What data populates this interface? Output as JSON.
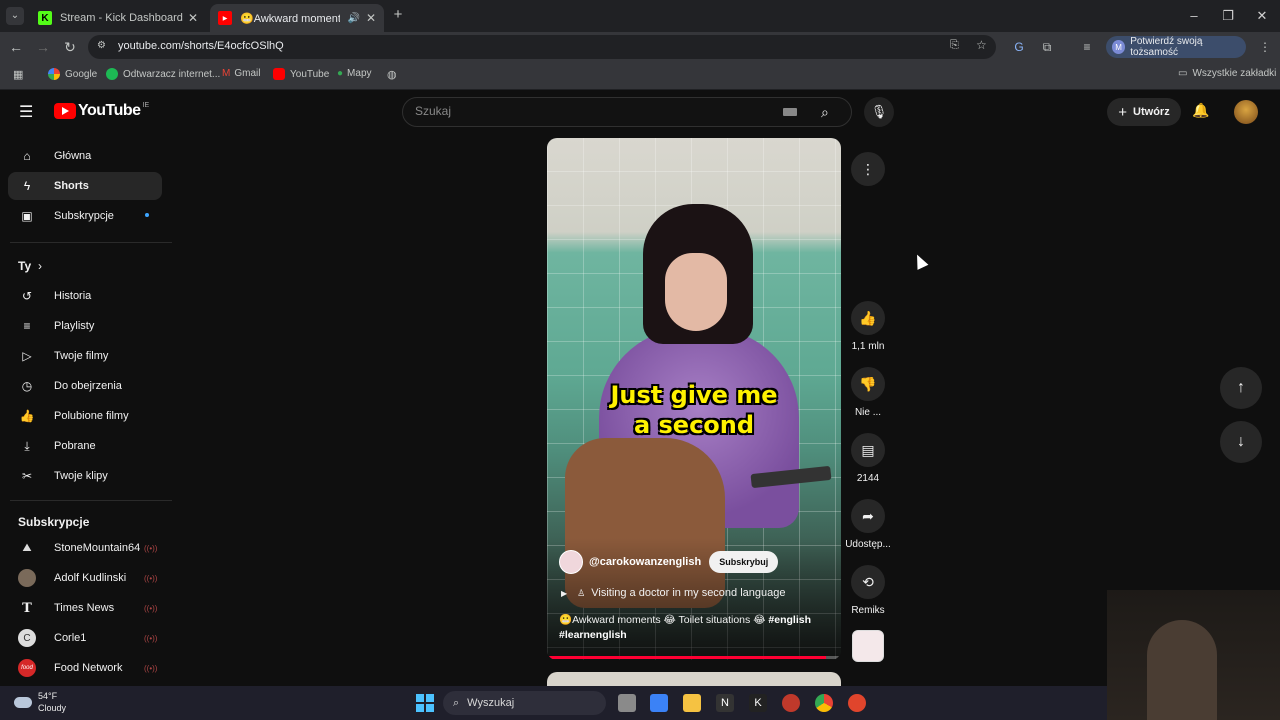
{
  "browser": {
    "tabs": [
      {
        "title": "Stream - Kick Dashboard",
        "icon": "kick-icon",
        "active": false
      },
      {
        "title": "😬Awkward moments 😂 | ",
        "icon": "youtube-icon",
        "active": true
      }
    ],
    "url": "youtube.com/shorts/E4ocfcOSlhQ",
    "identity_button": "Potwierdź swoją tożsamość",
    "identity_initial": "M",
    "bookmarks": [
      "Google",
      "Odtwarzacz internet...",
      "Gmail",
      "YouTube",
      "Mapy"
    ],
    "all_bookmarks": "Wszystkie zakładki"
  },
  "youtube": {
    "logo_text": "YouTube",
    "country_code": "IE",
    "search_placeholder": "Szukaj",
    "create_label": "Utwórz"
  },
  "sidebar": {
    "main": [
      {
        "label": "Główna",
        "icon": "home-icon"
      },
      {
        "label": "Shorts",
        "icon": "shorts-icon"
      },
      {
        "label": "Subskrypcje",
        "icon": "subscriptions-icon"
      }
    ],
    "you_heading": "Ty",
    "you_items": [
      {
        "label": "Historia",
        "icon": "history-icon"
      },
      {
        "label": "Playlisty",
        "icon": "playlists-icon"
      },
      {
        "label": "Twoje filmy",
        "icon": "your-videos-icon"
      },
      {
        "label": "Do obejrzenia",
        "icon": "watch-later-icon"
      },
      {
        "label": "Polubione filmy",
        "icon": "like-icon"
      },
      {
        "label": "Pobrane",
        "icon": "download-icon"
      },
      {
        "label": "Twoje klipy",
        "icon": "clips-icon"
      }
    ],
    "subs_heading": "Subskrypcje",
    "subscriptions": [
      {
        "name": "StoneMountain64",
        "avatar": "⛰",
        "color": "#333333"
      },
      {
        "name": "Adolf Kudlinski",
        "avatar": "",
        "color": "#7a6a5a"
      },
      {
        "name": "Times News",
        "avatar": "T",
        "color": "#0f0f0f"
      },
      {
        "name": "Corle1",
        "avatar": "C",
        "color": "#dddddd"
      },
      {
        "name": "Food Network",
        "avatar": "food",
        "color": "#d62828"
      }
    ]
  },
  "short": {
    "caption_line1": "Just give me",
    "caption_line2": "a second",
    "channel": "@carokowanzenglish",
    "subscribe": "Subskrybuj",
    "playlist": "Visiting a doctor in my second language",
    "desc_plain1": "😬Awkward moments 😂 Toilet situations 😂",
    "desc_tag1": "#english",
    "desc_tag2": "#learnenglish",
    "progress": 0.95
  },
  "actions": {
    "like": "1,1 mln",
    "dislike": "Nie ...",
    "comments": "2144",
    "share": "Udostęp...",
    "remix": "Remiks"
  },
  "taskbar": {
    "temp": "54°F",
    "weather": "Cloudy",
    "search": "Wyszukaj"
  },
  "colors": {
    "accent_red": "#ff0000",
    "caption_yellow": "#fff200",
    "background": "#0f0f0f"
  }
}
